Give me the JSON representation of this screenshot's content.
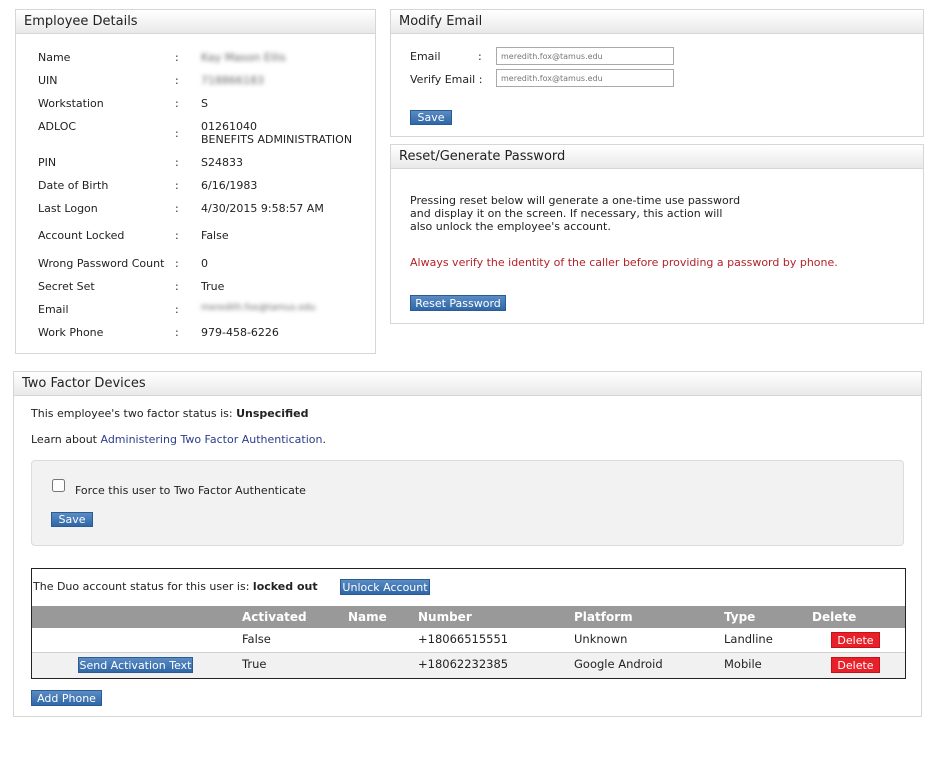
{
  "employee": {
    "title": "Employee Details",
    "rows": [
      {
        "label": "Name",
        "value": "Kay Mason Ellis"
      },
      {
        "label": "UIN",
        "value": "718866183"
      },
      {
        "label": "Workstation",
        "value": "S"
      },
      {
        "label": "ADLOC",
        "value": "01261040",
        "value2": "BENEFITS ADMINISTRATION"
      },
      {
        "label": "PIN",
        "value": "S24833"
      },
      {
        "label": "Date of Birth",
        "value": "6/16/1983"
      },
      {
        "label": "Last Logon",
        "value": "4/30/2015 9:58:57 AM"
      },
      {
        "label": "Account Locked",
        "value": "False"
      },
      {
        "label": "Wrong Password Count",
        "value": "0"
      },
      {
        "label": "Secret Set",
        "value": "True"
      },
      {
        "label": "Email",
        "value": "meredith.fox@tamus.edu"
      },
      {
        "label": "Work Phone",
        "value": "979-458-6226"
      }
    ]
  },
  "modify_email": {
    "title": "Modify Email",
    "email_label": "Email",
    "verify_label": "Verify Email :",
    "email_value": "meredith.fox@tamus.edu",
    "verify_value": "meredith.fox@tamus.edu",
    "save_label": "Save"
  },
  "reset_password": {
    "title": "Reset/Generate Password",
    "description_lines": [
      "Pressing reset below will generate a one-time use password",
      "and display it on the screen. If necessary, this action will",
      "also unlock the employee's account."
    ],
    "warning": "Always verify the identity of the caller before providing a password by phone.",
    "button_label": "Reset Password"
  },
  "two_factor": {
    "title": "Two Factor Devices",
    "status_prefix": "This employee's two factor status is:",
    "status_value": "Unspecified",
    "learn_prefix": "Learn about",
    "learn_link": "Administering Two Factor Authentication",
    "learn_suffix": ".",
    "force_label": "Force this user to Two Factor Authenticate",
    "force_checked": false,
    "save_label": "Save",
    "duo_prefix": "The Duo account status for this user is:",
    "duo_status": "locked out",
    "unlock_label": "Unlock Account",
    "columns": [
      "Activated",
      "Name",
      "Number",
      "Platform",
      "Type",
      "Delete"
    ],
    "devices": [
      {
        "action": "",
        "activated": "False",
        "name": "",
        "number": "+18066515551",
        "platform": "Unknown",
        "type": "Landline",
        "delete": "Delete"
      },
      {
        "action": "Send Activation Text",
        "activated": "True",
        "name": "",
        "number": "+18062232385",
        "platform": "Google Android",
        "type": "Mobile",
        "delete": "Delete"
      }
    ],
    "add_phone_label": "Add Phone"
  }
}
